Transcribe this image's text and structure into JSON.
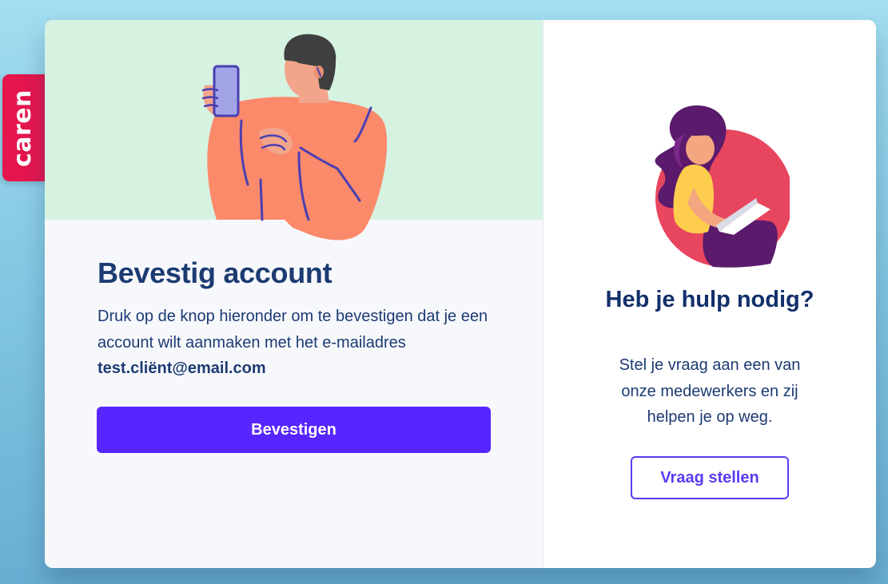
{
  "brand": {
    "logo_text": "caren",
    "color": "#e5154e"
  },
  "confirm": {
    "title": "Bevestig account",
    "description": "Druk op de knop hieronder om te bevestigen dat je een account wilt aanmaken met het e-mailadres",
    "email": "test.cliënt@email.com",
    "button_label": "Bevestigen",
    "button_color": "#5725ff",
    "hero_background": "#d6f3e2",
    "illustration": "man-with-phone-illustration"
  },
  "help": {
    "title": "Heb je hulp nodig?",
    "description": "Stel je vraag aan een van onze medewerkers en zij helpen je op weg.",
    "button_label": "Vraag stellen",
    "accent_color": "#5a3bf0",
    "illustration": "woman-with-laptop-illustration"
  }
}
